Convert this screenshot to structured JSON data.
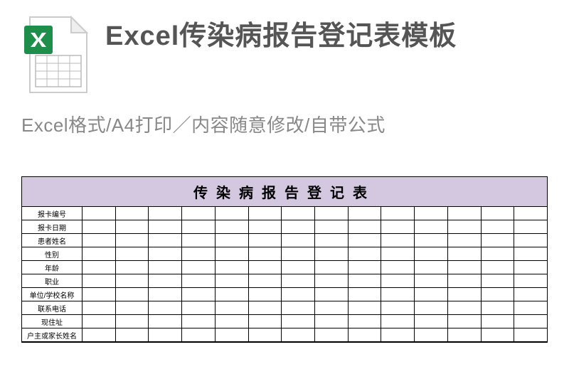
{
  "header": {
    "title": "Excel传染病报告登记表模板",
    "subtitle": "Excel格式/A4打印／内容随意修改/自带公式"
  },
  "icon": {
    "name": "excel-file-icon",
    "letter": "X"
  },
  "preview": {
    "sheet_title": "传染病报告登记表",
    "columns_count": 14,
    "rows": [
      "报卡编号",
      "报卡日期",
      "患者姓名",
      "性别",
      "年龄",
      "职业",
      "单位/学校名称",
      "联系电话",
      "现住址",
      "户主或家长姓名"
    ]
  }
}
